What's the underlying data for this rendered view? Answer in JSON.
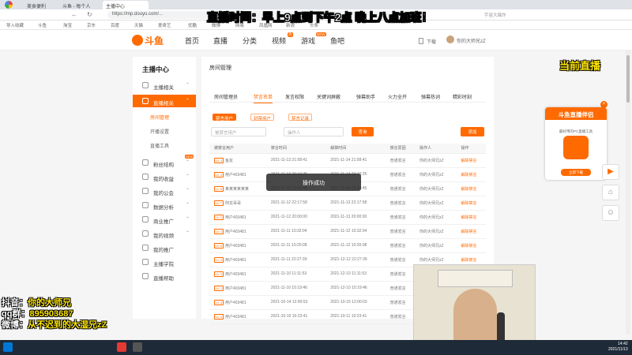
{
  "browser": {
    "tabs": [
      "美食便利",
      "斗鱼 - 每个人",
      "主播中心"
    ],
    "url": "https://mp.douyu.com/...",
    "bookmarks": [
      "导入收藏",
      "斗鱼",
      "淘宝",
      "京东",
      "百度",
      "天猫",
      "爱奇艺",
      "优酷",
      "微博",
      "网易",
      "凤凰网",
      "新浪",
      "头条"
    ],
    "search_placeholder": "宇宙大爆炸"
  },
  "header": {
    "logo": "斗鱼",
    "nav": [
      "首页",
      "直播",
      "分类",
      "视频",
      "游戏",
      "鱼吧"
    ],
    "badge_video": "热",
    "badge_game": "NEW",
    "download": "下载",
    "user": "你的大师兄zZ"
  },
  "sidebar": {
    "title": "主播中心",
    "items": [
      {
        "label": "主播相关"
      },
      {
        "label": "直播相关",
        "active": true
      },
      {
        "label": "粉丝结构"
      },
      {
        "label": "我的收益"
      },
      {
        "label": "我的公会"
      },
      {
        "label": "数据分析"
      },
      {
        "label": "商业推广"
      },
      {
        "label": "我的视频"
      },
      {
        "label": "我的推广"
      },
      {
        "label": "主播学院"
      },
      {
        "label": "直播帮助"
      }
    ],
    "subs": [
      "房间管理",
      "开播设置",
      "直播工具"
    ],
    "new_badge": "NEW"
  },
  "main": {
    "title": "房间管理",
    "tabs": [
      "房间管理员",
      "禁言名单",
      "发言权限",
      "关键词屏蔽",
      "弹幕助手",
      "火力全开",
      "弹幕热词",
      "精彩时刻"
    ],
    "active_tab": 1,
    "pills": [
      "禁言用户",
      "封禁用户",
      "禁言记录"
    ],
    "search1_placeholder": "被禁言用户",
    "search2_placeholder": "操作人",
    "query_btn": "查询",
    "add_btn": "添加",
    "columns": [
      "被禁言用户",
      "禁言时间",
      "解禁时间",
      "禁言原因",
      "操作人",
      "操作"
    ],
    "rows": [
      {
        "lv": "LV 3",
        "user": "鱼友",
        "t1": "2021-11-13 21:58:41",
        "t2": "2021-11-14 21:58:41",
        "reason": "普通发言",
        "op": "你的大师兄zZ",
        "act": "解除禁言"
      },
      {
        "lv": "LV 4",
        "user": "用户403481",
        "t1": "2021-11-13 20:10:25",
        "t2": "2021-11-14 20:10:25",
        "reason": "普通发言",
        "op": "你的大师兄zZ",
        "act": "解除禁言"
      },
      {
        "lv": "LV 5",
        "user": "某某某某某某",
        "t1": "2021-11-13 19:10:45",
        "t2": "2021-11-14 19:10:45",
        "reason": "普通发言",
        "op": "你的大师兄zZ",
        "act": "解除禁言"
      },
      {
        "lv": "LV 7",
        "user": "阿龙哥哥",
        "t1": "2021-11-12 22:17:58",
        "t2": "2021-11-13 22:17:58",
        "reason": "普通发言",
        "op": "你的大师兄zZ",
        "act": "解除禁言"
      },
      {
        "lv": "LV 2",
        "user": "用户403481",
        "t1": "2021-11-12 20:00:00",
        "t2": "2021-11-13 20:00:00",
        "reason": "普通发言",
        "op": "你的大师兄zZ",
        "act": "解除禁言"
      },
      {
        "lv": "LV 3",
        "user": "用户403481",
        "t1": "2021-11-11 10:32:04",
        "t2": "2021-11-12 10:32:04",
        "reason": "普通发言",
        "op": "你的大师兄zZ",
        "act": "解除禁言"
      },
      {
        "lv": "LV 5",
        "user": "用户403481",
        "t1": "2021-11-11 10:20:08",
        "t2": "2021-11-12 10:20:08",
        "reason": "普通发言",
        "op": "你的大师兄zZ",
        "act": "解除禁言"
      },
      {
        "lv": "LV 3",
        "user": "用户403481",
        "t1": "2021-11-11 22:27:39",
        "t2": "2021-12-12 22:27:39",
        "reason": "普通发言",
        "op": "你的大师兄zZ",
        "act": "解除禁言"
      },
      {
        "lv": "LV 3",
        "user": "用户403481",
        "t1": "2021-11-10 11:11:53",
        "t2": "2021-12-10 11:11:53",
        "reason": "普通发言",
        "op": "你的大师兄zZ",
        "act": "解除禁言"
      },
      {
        "lv": "LV 2",
        "user": "用户403481",
        "t1": "2021-11-10 15:19:46",
        "t2": "2021-12-10 15:19:46",
        "reason": "普通发言",
        "op": "你的大师兄zZ",
        "act": "解除禁言"
      },
      {
        "lv": "LV 3",
        "user": "用户403481",
        "t1": "2021-10-14 12:00:03",
        "t2": "2021-10-15 12:00:03",
        "reason": "普通发言",
        "op": "你的大师兄zZ",
        "act": "解除禁言"
      },
      {
        "lv": "LV 3",
        "user": "用户403481",
        "t1": "2021-10-10 10:23:41",
        "t2": "2021-10-11 10:23:41",
        "reason": "普通发言",
        "op": "你的大师兄zZ",
        "act": "解除禁言"
      }
    ]
  },
  "toast": "操作成功",
  "overlay": {
    "top": "直播时间：早上9点到下午2点   晚上八点加班！",
    "live": "当前直播",
    "douyin_label": "抖音：",
    "douyin_val": "你的大师兄",
    "qq_label": "qq群：",
    "qq_val": "895903687",
    "weibo_label": "微博：",
    "weibo_val": "从不迟到的大湿兄zZ"
  },
  "ad": {
    "title": "斗鱼直播伴侣",
    "sub": "最好用的PC直播工具",
    "btn": "立即下载"
  },
  "clock": {
    "time": "14:42",
    "date": "2021/11/13"
  },
  "colors": {
    "accent": "#ff6a00",
    "taskbar": "#1f2a38"
  }
}
